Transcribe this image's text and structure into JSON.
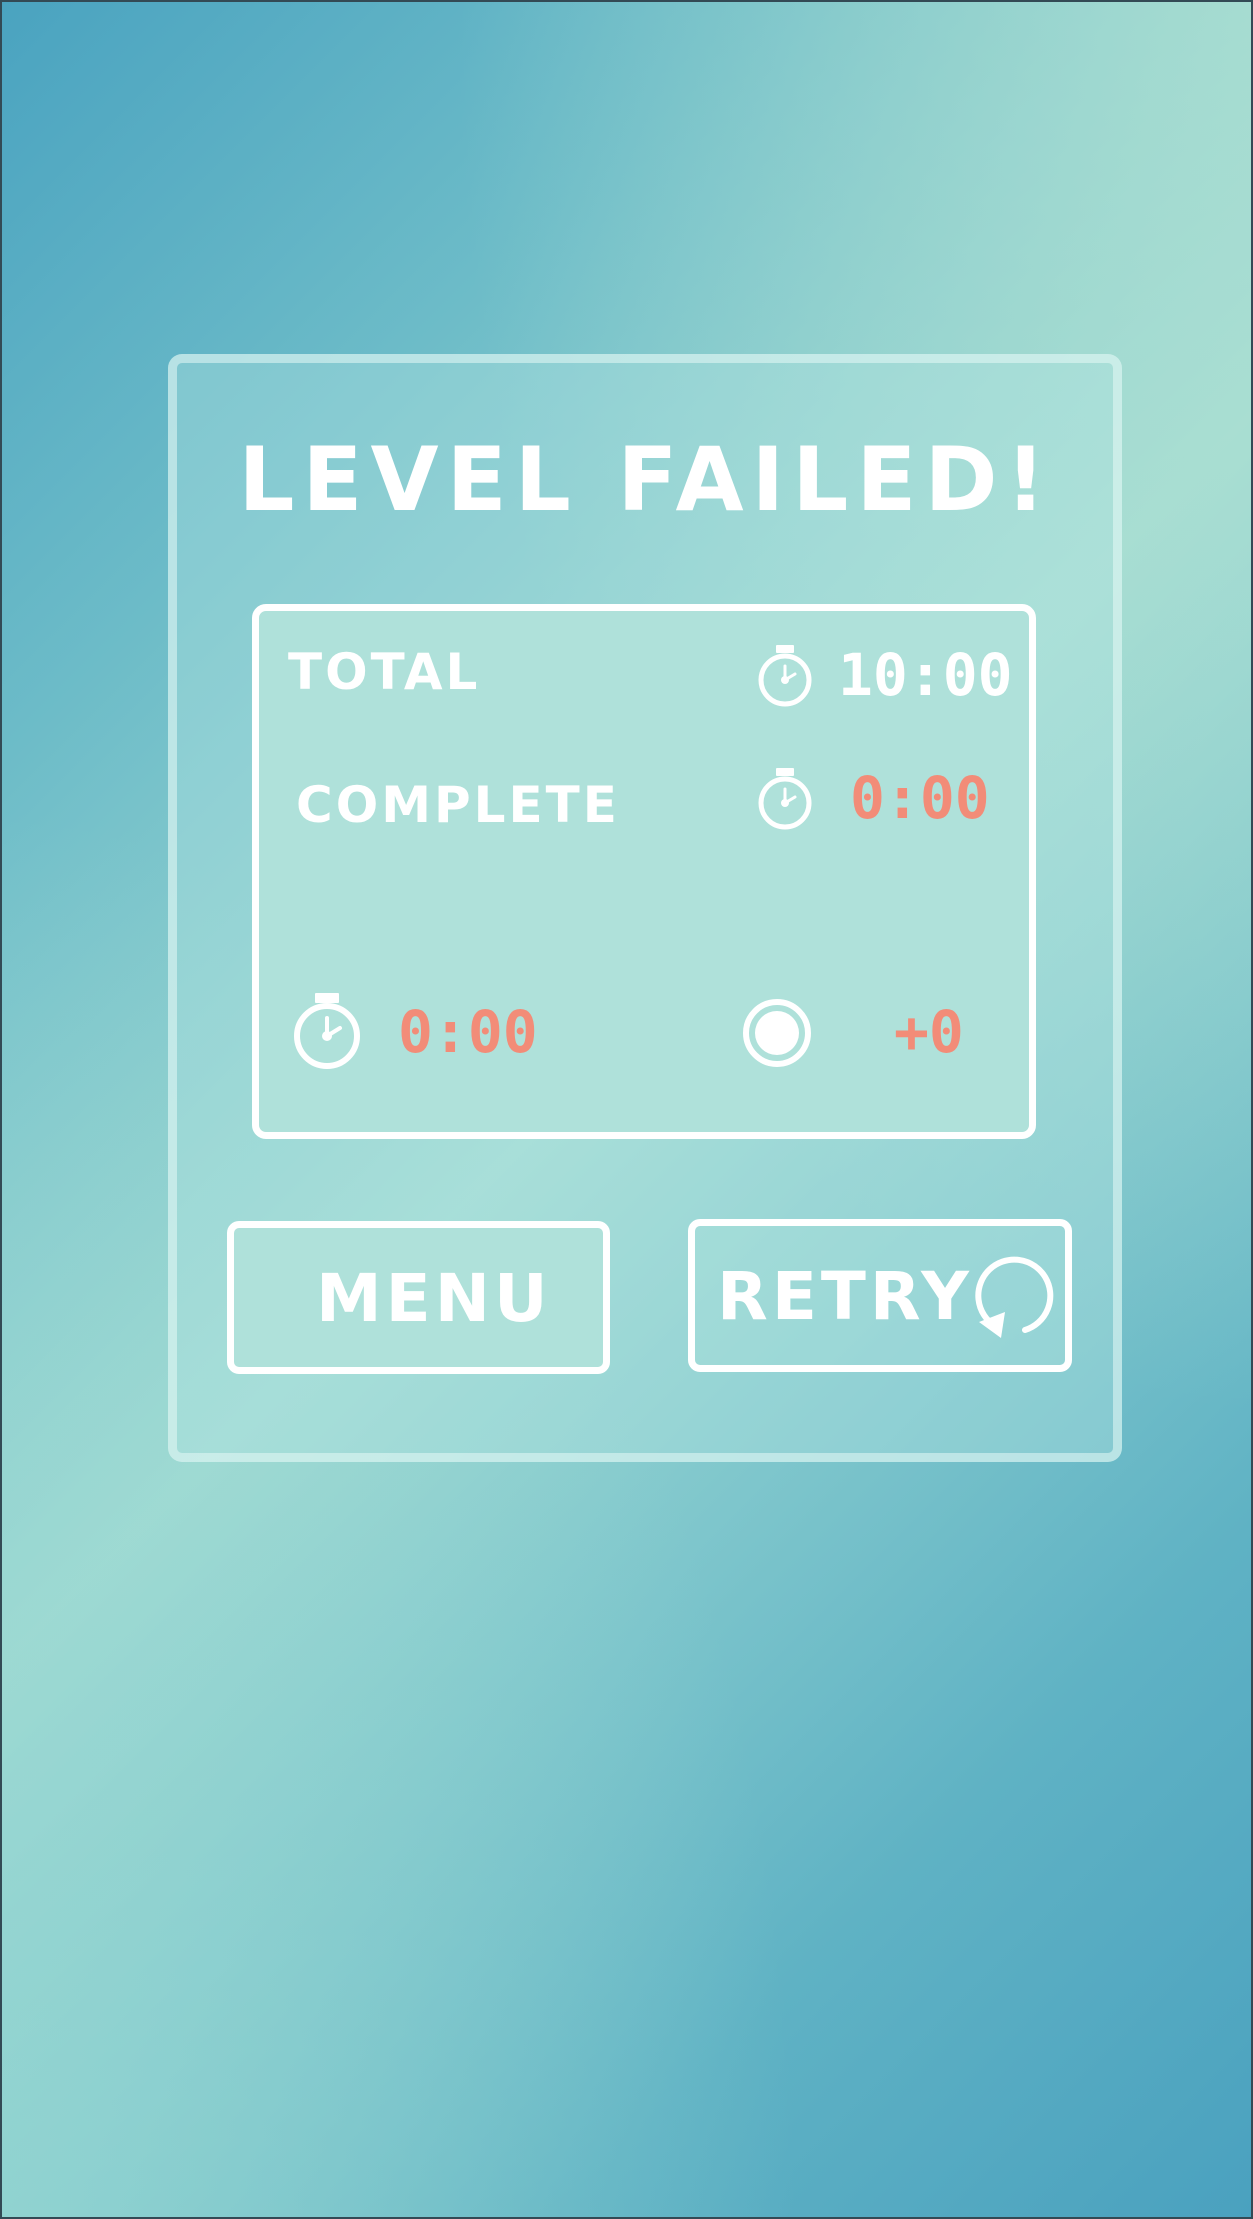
{
  "dialog": {
    "title": "LEVEL FAILED!"
  },
  "stats": {
    "total_label": "TOTAL",
    "total_time": "10:00",
    "complete_label": "COMPLETE",
    "complete_time": "0:00",
    "elapsed_time": "0:00",
    "bonus_points": "+0"
  },
  "buttons": {
    "menu_label": "MENU",
    "retry_label": "RETRY"
  },
  "icons": {
    "stopwatch": "stopwatch-icon",
    "coin": "coin-icon",
    "retry": "retry-arrow-icon"
  },
  "colors": {
    "text": "#ffffff",
    "accent_red": "#f28c78",
    "panel_fill": "#afe1da"
  }
}
